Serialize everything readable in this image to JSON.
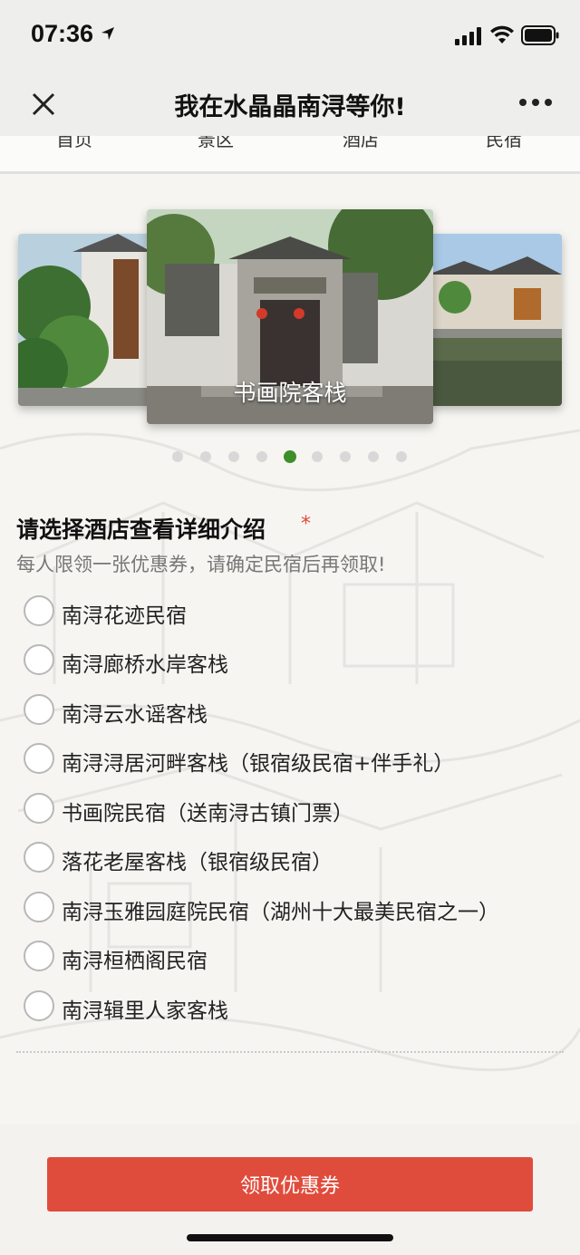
{
  "status_bar": {
    "time": "07:36"
  },
  "nav": {
    "title": "我在水晶晶南浔等你!"
  },
  "tabs": [
    {
      "label": "首页"
    },
    {
      "label": "景区"
    },
    {
      "label": "酒店"
    },
    {
      "label": "民宿"
    }
  ],
  "carousel": {
    "center_caption": "书画院客栈",
    "dot_count": 9,
    "active_dot": 5
  },
  "question": {
    "title": "请选择酒店查看详细介绍",
    "required_mark": "*",
    "description": "每人限领一张优惠券，请确定民宿后再领取!",
    "options": [
      {
        "label": "南浔花迹民宿"
      },
      {
        "label": "南浔廊桥水岸客栈"
      },
      {
        "label": "南浔云水谣客栈"
      },
      {
        "label": "南浔浔居河畔客栈（银宿级民宿+伴手礼）"
      },
      {
        "label": "书画院民宿（送南浔古镇门票）"
      },
      {
        "label": "落花老屋客栈（银宿级民宿）"
      },
      {
        "label": "南浔玉雅园庭院民宿（湖州十大最美民宿之一）"
      },
      {
        "label": "南浔桓栖阁民宿"
      },
      {
        "label": "南浔辑里人家客栈"
      }
    ]
  },
  "submit_button": {
    "label": "领取优惠券"
  },
  "colors": {
    "accent_red": "#e04c3c",
    "active_dot_green": "#3e8e2a",
    "required_star": "#e04a3a"
  }
}
